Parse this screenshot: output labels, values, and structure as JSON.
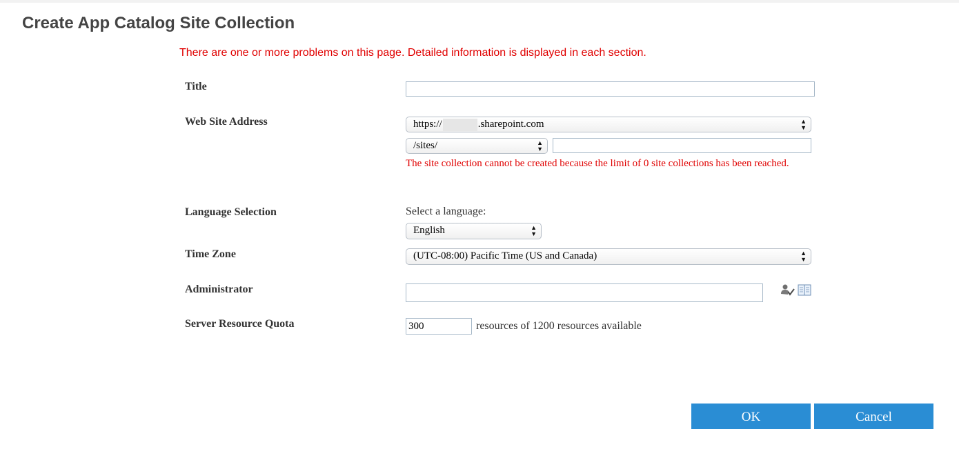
{
  "page": {
    "title": "Create App Catalog Site Collection",
    "error_summary": "There are one or more problems on this page. Detailed information is displayed in each section."
  },
  "form": {
    "title": {
      "label": "Title",
      "value": ""
    },
    "web_site_address": {
      "label": "Web Site Address",
      "domain_prefix": "https://",
      "domain_suffix": ".sharepoint.com",
      "path_option": "/sites/",
      "url_value": "",
      "error": "The site collection cannot be created because the limit of 0 site collections has been reached."
    },
    "language": {
      "label": "Language Selection",
      "hint": "Select a language:",
      "selected": "English"
    },
    "time_zone": {
      "label": "Time Zone",
      "selected": "(UTC-08:00) Pacific Time (US and Canada)"
    },
    "administrator": {
      "label": "Administrator",
      "value": "",
      "check_names_icon": "check-names-icon",
      "browse_icon": "address-book-icon"
    },
    "quota": {
      "label": "Server Resource Quota",
      "value": "300",
      "suffix": "resources of 1200 resources available"
    }
  },
  "buttons": {
    "ok": "OK",
    "cancel": "Cancel"
  },
  "colors": {
    "error": "#e00000",
    "button": "#2a8dd4",
    "input_border": "#a6b8c8"
  }
}
